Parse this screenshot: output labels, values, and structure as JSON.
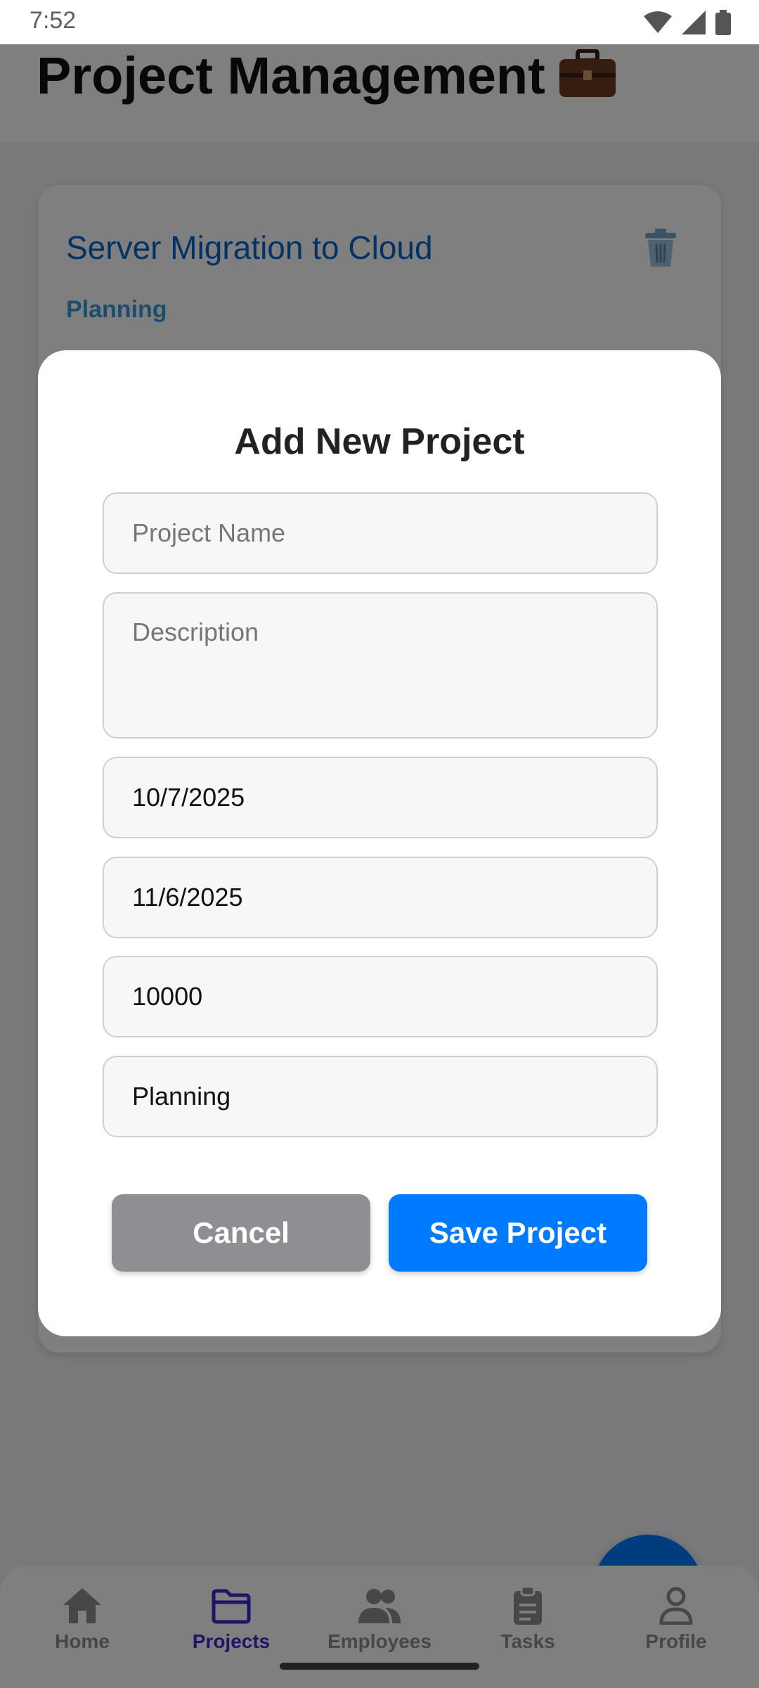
{
  "status_bar": {
    "time": "7:52",
    "icons": [
      "wifi-icon",
      "signal-icon",
      "battery-icon"
    ]
  },
  "header": {
    "title": "Project Management",
    "title_icon": "briefcase-icon"
  },
  "project_card": {
    "title": "Server Migration to Cloud",
    "status": "Planning",
    "delete_icon": "trash-icon"
  },
  "fab": {
    "icon": "plus-icon"
  },
  "bottom_nav": {
    "items": [
      {
        "label": "Home",
        "icon": "home-icon",
        "active": false
      },
      {
        "label": "Projects",
        "icon": "folder-icon",
        "active": true
      },
      {
        "label": "Employees",
        "icon": "people-icon",
        "active": false
      },
      {
        "label": "Tasks",
        "icon": "clipboard-icon",
        "active": false
      },
      {
        "label": "Profile",
        "icon": "person-icon",
        "active": false
      }
    ]
  },
  "modal": {
    "title": "Add New Project",
    "fields": {
      "project_name": {
        "value": "",
        "placeholder": "Project Name"
      },
      "description": {
        "value": "",
        "placeholder": "Description"
      },
      "start_date": {
        "value": "10/7/2025"
      },
      "end_date": {
        "value": "11/6/2025"
      },
      "budget": {
        "value": "10000"
      },
      "status": {
        "value": "Planning"
      }
    },
    "cancel_label": "Cancel",
    "save_label": "Save Project"
  },
  "colors": {
    "primary": "#007aff",
    "card_title": "#0a64c8",
    "status_text": "#3a9bd9",
    "nav_active": "#3a2dc8",
    "cancel_button": "#8e8e93"
  }
}
